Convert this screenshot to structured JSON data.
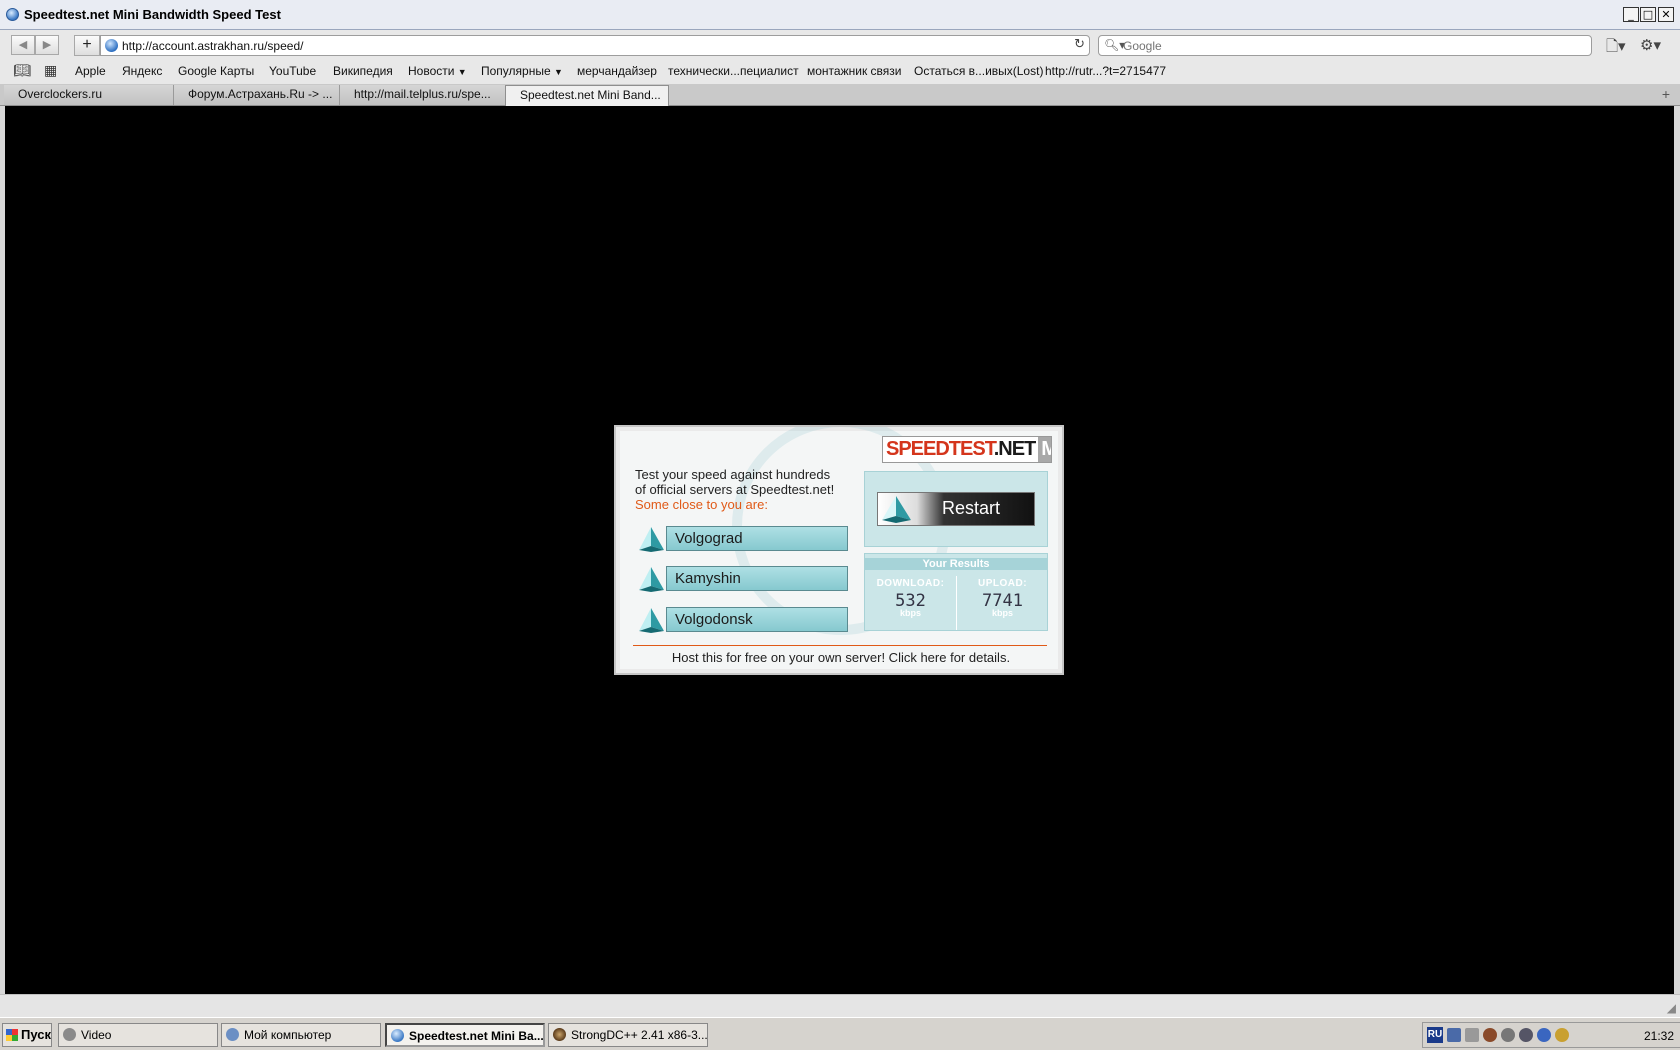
{
  "window": {
    "title": "Speedtest.net Mini Bandwidth Speed Test"
  },
  "nav": {
    "url": "http://account.astrakhan.ru/speed/",
    "search_placeholder": "Google"
  },
  "bookmarks": [
    "Apple",
    "Яндекс",
    "Google Карты",
    "YouTube",
    "Википедия",
    "Новости",
    "Популярные",
    "мерчандайзер",
    "технически...пециалист",
    "монтажник связи",
    "Остаться в...ивых(Lost)",
    "http://rutr...?t=2715477"
  ],
  "tabs": [
    {
      "label": "Overclockers.ru"
    },
    {
      "label": "Форум.Астрахань.Ru -> ..."
    },
    {
      "label": "http://mail.telplus.ru/spe..."
    },
    {
      "label": "Speedtest.net Mini Band..."
    }
  ],
  "widget": {
    "logo": {
      "speed": "SPEEDTEST",
      "net": ".NET",
      "mini": "MINI"
    },
    "intro_line1": "Test your speed against hundreds",
    "intro_line2": "of official servers at Speedtest.net!",
    "intro_line3": "Some close to you are:",
    "servers": [
      "Volgograd",
      "Kamyshin",
      "Volgodonsk"
    ],
    "restart_label": "Restart",
    "results_title": "Your Results",
    "download_label": "DOWNLOAD:",
    "download_value": "532",
    "download_unit": "kbps",
    "upload_label": "UPLOAD:",
    "upload_value": "7741",
    "upload_unit": "kbps",
    "host_text": "Host this for free on your own server! Click here for details."
  },
  "taskbar": {
    "start_label": "Пуск",
    "items": [
      "Video",
      "Мой компьютер",
      "Speedtest.net Mini Ba...",
      "StrongDC++ 2.41 x86-3..."
    ],
    "lang": "RU",
    "clock": "21:32"
  },
  "colors": {
    "accent": "#e05a18",
    "server_bar": "#9fd8dc",
    "logo_red": "#d4351c"
  }
}
